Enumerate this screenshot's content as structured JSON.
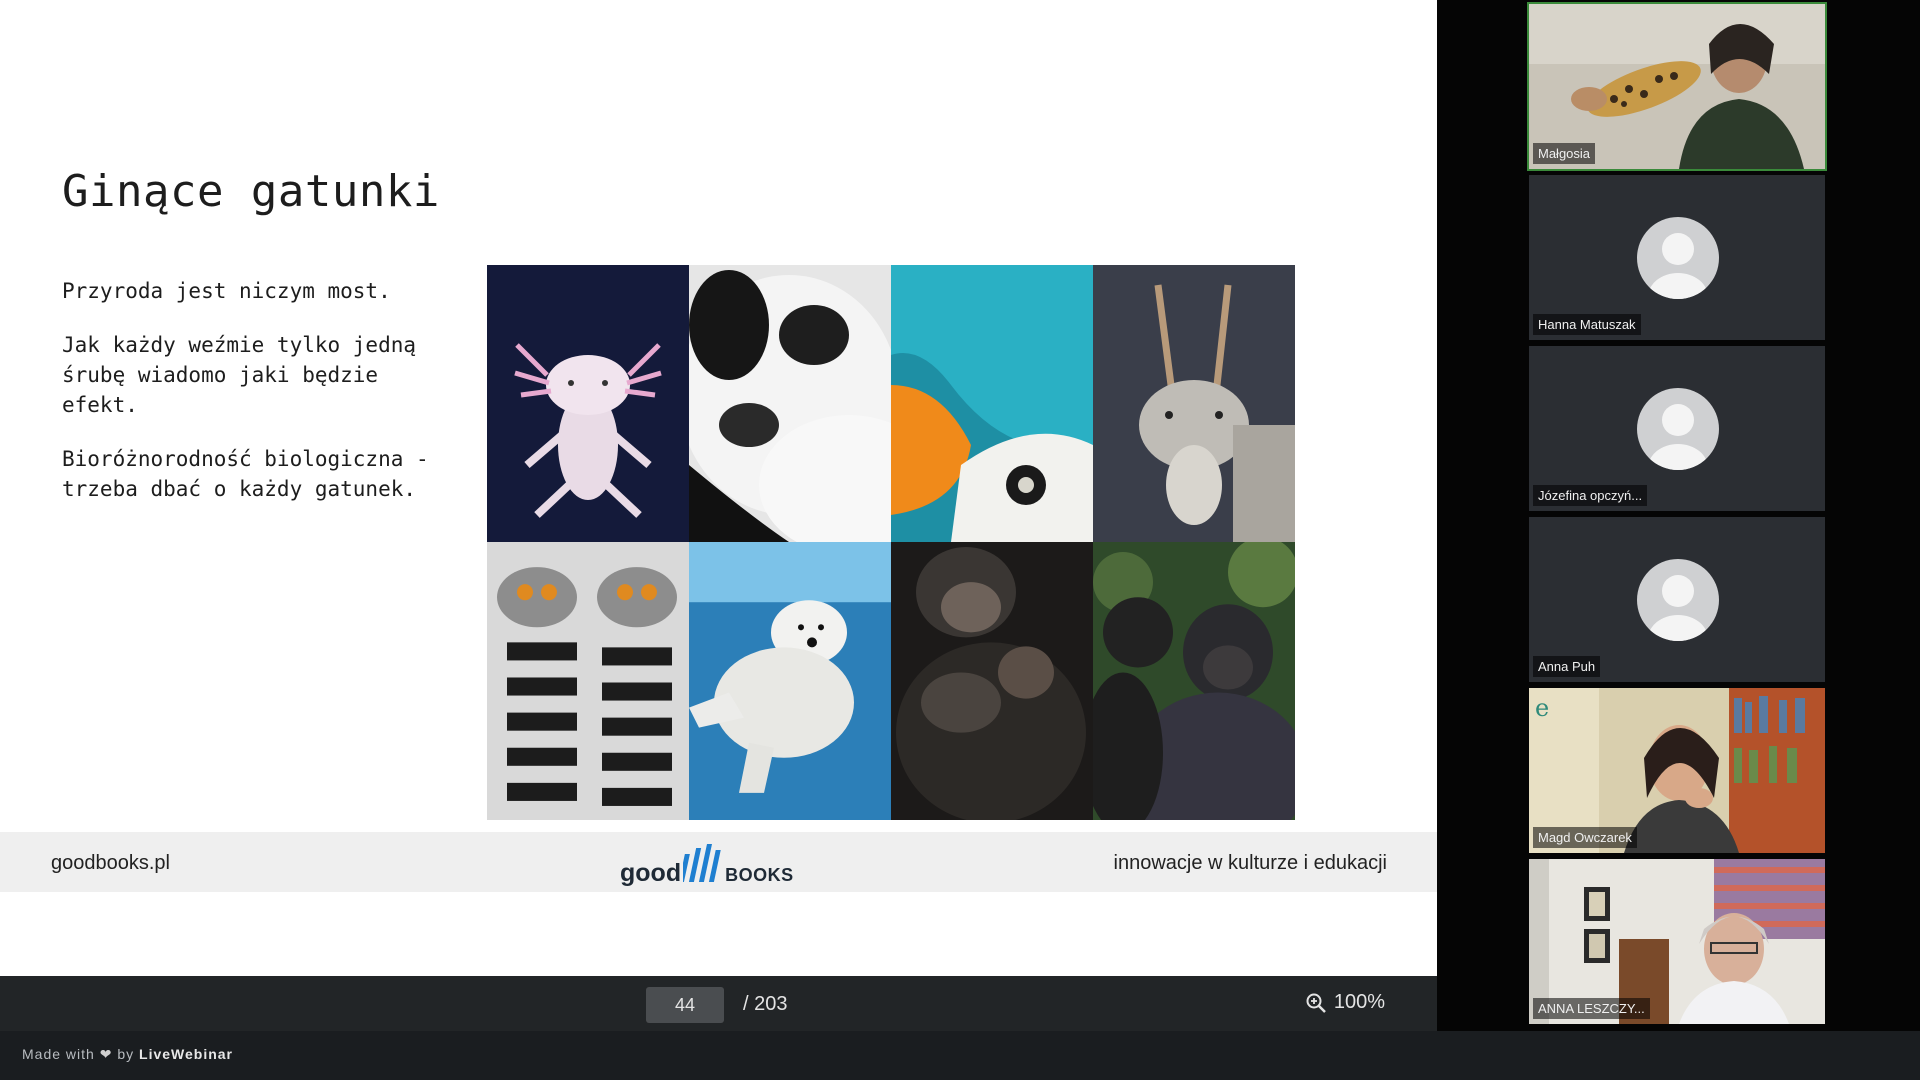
{
  "slide": {
    "title": "Ginące gatunki",
    "paragraphs": [
      "Przyroda jest niczym most.",
      "Jak każdy weźmie tylko jedną śrubę wiadomo jaki będzie efekt.",
      "Bioróżnorodność biologiczna - trzeba dbać o każdy gatunek."
    ],
    "footer": {
      "site": "goodbooks.pl",
      "logo_word1": "good",
      "logo_word2": "books",
      "tagline": "innowacje w kulturze i edukacji"
    }
  },
  "pager": {
    "current_page": "44",
    "total": "/ 203",
    "zoom": "100%"
  },
  "participants": [
    {
      "name": "Małgosia"
    },
    {
      "name": "Hanna Matuszak"
    },
    {
      "name": "Józefina opczyń..."
    },
    {
      "name": "Anna Puh"
    },
    {
      "name": "Magd Owczarek"
    },
    {
      "name": "ANNA LESZCZY..."
    }
  ],
  "branding": {
    "prefix": "Made with",
    "middle": "by",
    "brand": "LiveWebinar"
  },
  "colors": {
    "accent_active": "#3a8a3a",
    "bar_bg": "#222527",
    "logo": "#1f2a36"
  }
}
